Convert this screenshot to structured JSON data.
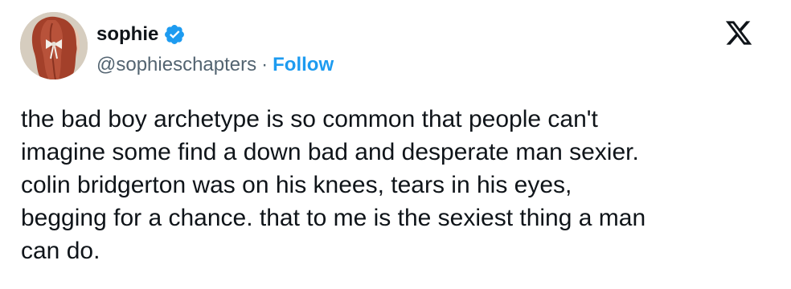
{
  "author": {
    "display_name": "sophie",
    "handle": "@sophieschapters",
    "verified": true,
    "avatar_icon": "avatar-photo-red-hair-bow"
  },
  "actions": {
    "separator": "·",
    "follow_label": "Follow"
  },
  "brand": {
    "logo_icon": "x-logo-icon"
  },
  "tweet": {
    "lines": [
      "the bad boy archetype is so common that people can't",
      "imagine some find a down bad and desperate man sexier.",
      "colin bridgerton was on his knees, tears in his eyes,",
      "begging for a chance. that to me is the sexiest thing a man",
      "can do."
    ]
  },
  "colors": {
    "text": "#0f1419",
    "secondary": "#536471",
    "accent": "#1d9bf0",
    "background": "#ffffff"
  }
}
